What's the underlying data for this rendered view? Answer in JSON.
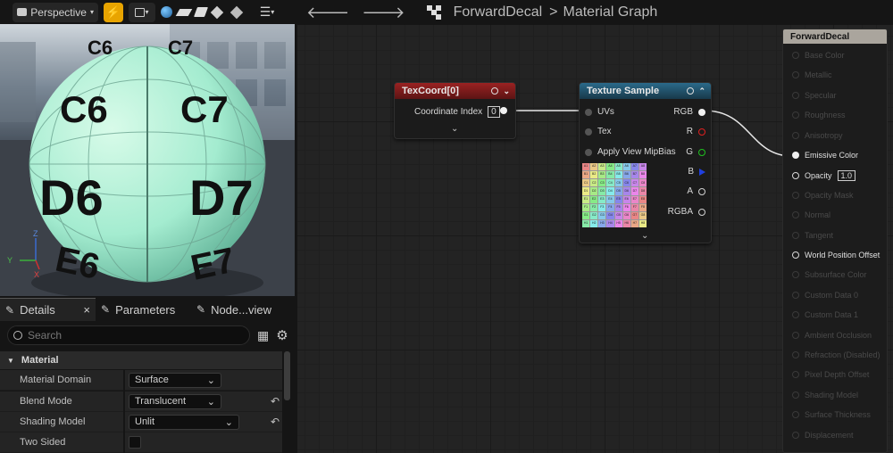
{
  "viewport": {
    "mode_label": "Perspective",
    "sphere_labels": [
      "C6",
      "C7",
      "D6",
      "D7",
      "E6",
      "E7",
      "C6",
      "C7"
    ],
    "axis_labels": {
      "z": "Z",
      "y": "Y",
      "x": "X"
    }
  },
  "panel": {
    "tabs": [
      {
        "label": "Details",
        "icon": "details-icon"
      },
      {
        "label": "Parameters",
        "icon": "parameters-icon"
      },
      {
        "label": "Node...view",
        "icon": "node-preview-icon"
      }
    ],
    "close_glyph": "×",
    "search_placeholder": "Search",
    "category": "Material",
    "properties": [
      {
        "label": "Material Domain",
        "value": "Surface",
        "reset": false
      },
      {
        "label": "Blend Mode",
        "value": "Translucent",
        "reset": true
      },
      {
        "label": "Shading Model",
        "value": "Unlit",
        "reset": true
      },
      {
        "label": "Two Sided",
        "value": "",
        "reset": false
      }
    ]
  },
  "graph": {
    "asset_name": "ForwardDecal",
    "graph_name": "Material Graph",
    "separator": ">",
    "texcoord_node": {
      "title": "TexCoord[0]",
      "pin_label": "Coordinate Index",
      "pin_value": "0"
    },
    "texture_node": {
      "title": "Texture Sample",
      "inputs": [
        "UVs",
        "Tex",
        "Apply View MipBias"
      ],
      "outputs": [
        "RGB",
        "R",
        "G",
        "B",
        "A",
        "RGBA"
      ],
      "grid_rows": [
        [
          "A1",
          "A2",
          "A3",
          "A4",
          "A5",
          "A6",
          "A7",
          "A8"
        ],
        [
          "B1",
          "B2",
          "B3",
          "B4",
          "B5",
          "B6",
          "B7",
          "B8"
        ],
        [
          "C1",
          "C2",
          "C3",
          "C4",
          "C5",
          "C6",
          "C7",
          "C8"
        ],
        [
          "D1",
          "D2",
          "D3",
          "D4",
          "D5",
          "D6",
          "D7",
          "D8"
        ],
        [
          "E1",
          "E2",
          "E3",
          "E4",
          "E5",
          "E6",
          "E7",
          "E8"
        ],
        [
          "F1",
          "F2",
          "F3",
          "F4",
          "F5",
          "F6",
          "F7",
          "F8"
        ],
        [
          "G1",
          "G2",
          "G3",
          "G4",
          "G5",
          "G6",
          "G7",
          "G8"
        ],
        [
          "H1",
          "H2",
          "H3",
          "H4",
          "H5",
          "H6",
          "H7",
          "H8"
        ]
      ]
    },
    "result_node": {
      "title": "ForwardDecal",
      "opacity_value": "1.0",
      "pins": [
        {
          "label": "Base Color",
          "active": false
        },
        {
          "label": "Metallic",
          "active": false
        },
        {
          "label": "Specular",
          "active": false
        },
        {
          "label": "Roughness",
          "active": false
        },
        {
          "label": "Anisotropy",
          "active": false
        },
        {
          "label": "Emissive Color",
          "active": true
        },
        {
          "label": "Opacity",
          "active": true
        },
        {
          "label": "Opacity Mask",
          "active": false
        },
        {
          "label": "Normal",
          "active": false
        },
        {
          "label": "Tangent",
          "active": false
        },
        {
          "label": "World Position Offset",
          "active": true
        },
        {
          "label": "Subsurface Color",
          "active": false
        },
        {
          "label": "Custom Data 0",
          "active": false
        },
        {
          "label": "Custom Data 1",
          "active": false
        },
        {
          "label": "Ambient Occlusion",
          "active": false
        },
        {
          "label": "Refraction (Disabled)",
          "active": false
        },
        {
          "label": "Pixel Depth Offset",
          "active": false
        },
        {
          "label": "Shading Model",
          "active": false
        },
        {
          "label": "Surface Thickness",
          "active": false
        },
        {
          "label": "Displacement",
          "active": false
        }
      ]
    }
  },
  "colors": {
    "accent": "#f0a400",
    "texcoord_header": "#8a1a1a",
    "texture_header": "#1f4f68",
    "pin_r": "#e02020",
    "pin_g": "#20c020",
    "pin_b": "#2040e0"
  }
}
